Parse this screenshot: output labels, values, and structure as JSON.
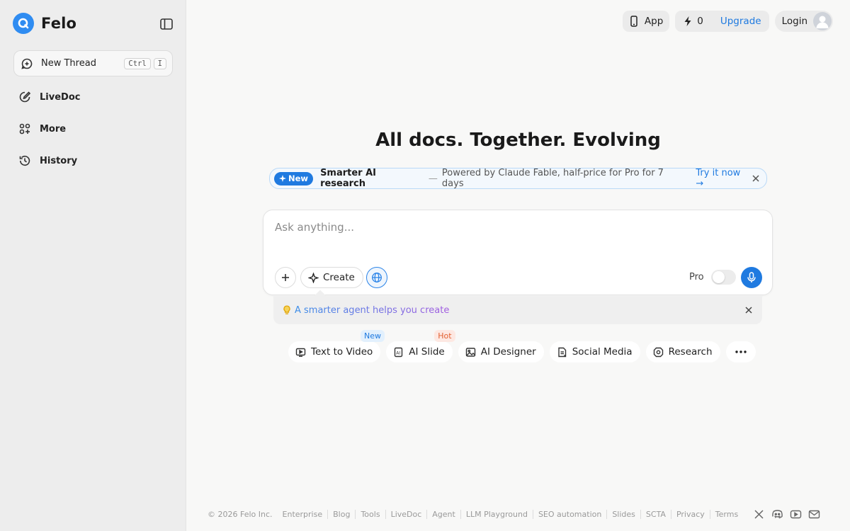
{
  "brand": {
    "name": "Felo"
  },
  "sidebar": {
    "new_thread": {
      "label": "New Thread",
      "shortcut_ctrl": "Ctrl",
      "shortcut_key": "I"
    },
    "items": [
      {
        "label": "LiveDoc",
        "icon": "edit-circle-icon"
      },
      {
        "label": "More",
        "icon": "apps-icon"
      },
      {
        "label": "History",
        "icon": "history-icon"
      }
    ]
  },
  "topbar": {
    "app_label": "App",
    "credits": "0",
    "upgrade_label": "Upgrade",
    "login_label": "Login"
  },
  "main": {
    "headline": "All docs. Together. Evolving",
    "banner": {
      "tag": "New",
      "title": "Smarter AI research",
      "dash": "—",
      "description": "Powered by Claude Fable, half-price for Pro for 7 days",
      "cta": "Try it now →"
    },
    "composer": {
      "placeholder": "Ask anything...",
      "create_label": "Create",
      "pro_label": "Pro"
    },
    "hint": {
      "text": "A smarter agent helps you create"
    },
    "chips": [
      {
        "label": "Text to Video",
        "icon": "video-icon",
        "badge": "New"
      },
      {
        "label": "AI Slide",
        "icon": "slide-icon",
        "badge": "Hot"
      },
      {
        "label": "AI Designer",
        "icon": "image-icon"
      },
      {
        "label": "Social Media",
        "icon": "social-icon"
      },
      {
        "label": "Research",
        "icon": "research-icon"
      }
    ]
  },
  "footer": {
    "copyright": "© 2026  Felo Inc.",
    "links": [
      "Enterprise",
      "Blog",
      "Tools",
      "LiveDoc",
      "Agent",
      "LLM Playground",
      "SEO automation",
      "Slides",
      "SCTA",
      "Privacy",
      "Terms"
    ]
  },
  "colors": {
    "accent": "#1f7ae0",
    "sidebar_bg": "#ededed",
    "page_bg": "#f8f8f7",
    "hot": "#e25f2f"
  }
}
